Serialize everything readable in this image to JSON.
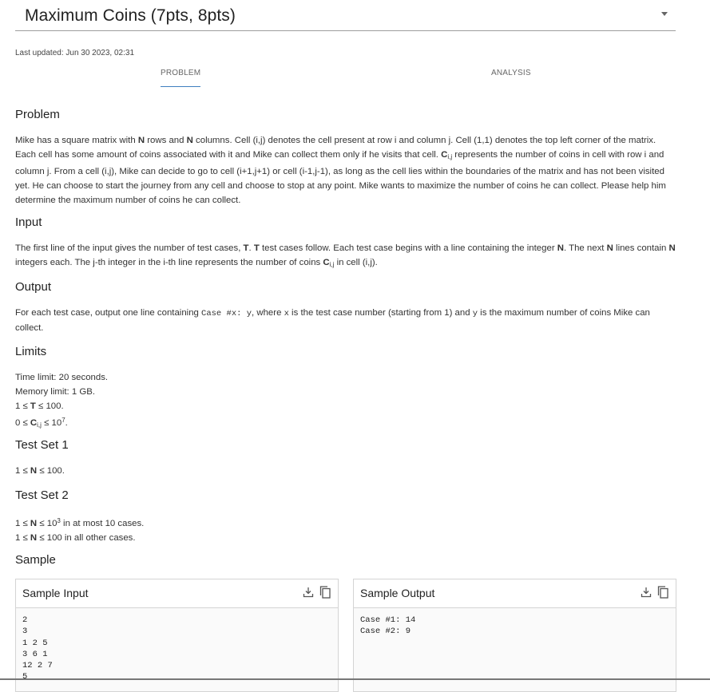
{
  "header": {
    "title": "Maximum Coins (7pts, 8pts)",
    "dropdown_icon": "chevron-down-icon"
  },
  "last_updated": "Last updated: Jun 30 2023, 02:31",
  "tabs": [
    {
      "label": "PROBLEM",
      "active": true
    },
    {
      "label": "ANALYSIS",
      "active": false
    }
  ],
  "accent_color": "#3f7fbf",
  "sections": {
    "problem": {
      "heading": "Problem",
      "t1": "Mike has a square matrix with ",
      "n1": "N",
      "t2": " rows and ",
      "n2": "N",
      "t3": " columns. Cell (i,j) denotes the cell present at row i and column j. Cell (1,1) denotes the top left corner of the matrix. Each cell has some amount of coins associated with it and Mike can collect them only if he visits that cell. ",
      "c": "C",
      "sub": "i,j",
      "t4": " represents the number of coins in cell with row i and column j. From a cell (i,j), Mike can decide to go to cell (i+1,j+1) or cell (i-1,j-1), as long as the cell lies within the boundaries of the matrix and has not been visited yet. He can choose to start the journey from any cell and choose to stop at any point. Mike wants to maximize the number of coins he can collect. Please help him determine the maximum number of coins he can collect."
    },
    "input": {
      "heading": "Input",
      "t1": "The first line of the input gives the number of test cases, ",
      "T1": "T",
      "t2": ". ",
      "T2": "T",
      "t3": " test cases follow. Each test case begins with a line containing the integer ",
      "N1": "N",
      "t4": ". The next ",
      "N2": "N",
      "t5": " lines contain ",
      "N3": "N",
      "t6": " integers each. The j-th integer in the i-th line represents the number of coins ",
      "c": "C",
      "sub": "i,j",
      "t7": " in cell (i,j)."
    },
    "output": {
      "heading": "Output",
      "t1": "For each test case, output one line containing ",
      "code": "Case #x: y",
      "t2": ", where ",
      "x": "x",
      "t3": " is the test case number (starting from 1) and ",
      "y": "y",
      "t4": " is the maximum number of coins Mike can collect."
    },
    "limits": {
      "heading": "Limits",
      "time": "Time limit: 20 seconds.",
      "memory": "Memory limit: 1 GB.",
      "l3_a": "1 ≤ ",
      "l3_b": "T",
      "l3_c": " ≤ 100.",
      "l4_a": "0 ≤ ",
      "l4_b": "C",
      "l4_sub": "i,j",
      "l4_c": " ≤ 10",
      "l4_sup": "7",
      "l4_d": "."
    },
    "test_set_1": {
      "heading": "Test Set 1",
      "l1_a": "1 ≤ ",
      "l1_b": "N",
      "l1_c": " ≤ 100."
    },
    "test_set_2": {
      "heading": "Test Set 2",
      "l1_a": "1 ≤ ",
      "l1_b": "N",
      "l1_c": " ≤ 10",
      "l1_sup": "3",
      "l1_d": " in at most 10 cases.",
      "l2_a": "1 ≤ ",
      "l2_b": "N",
      "l2_c": " ≤ 100 in all other cases."
    },
    "sample": {
      "heading": "Sample"
    }
  },
  "sample_input": {
    "title": "Sample Input",
    "body": "2\n3\n1 2 5\n3 6 1\n12 2 7\n5",
    "icons": [
      "download-icon",
      "copy-icon"
    ]
  },
  "sample_output": {
    "title": "Sample Output",
    "body": "Case #1: 14\nCase #2: 9",
    "icons": [
      "download-icon",
      "copy-icon"
    ]
  }
}
